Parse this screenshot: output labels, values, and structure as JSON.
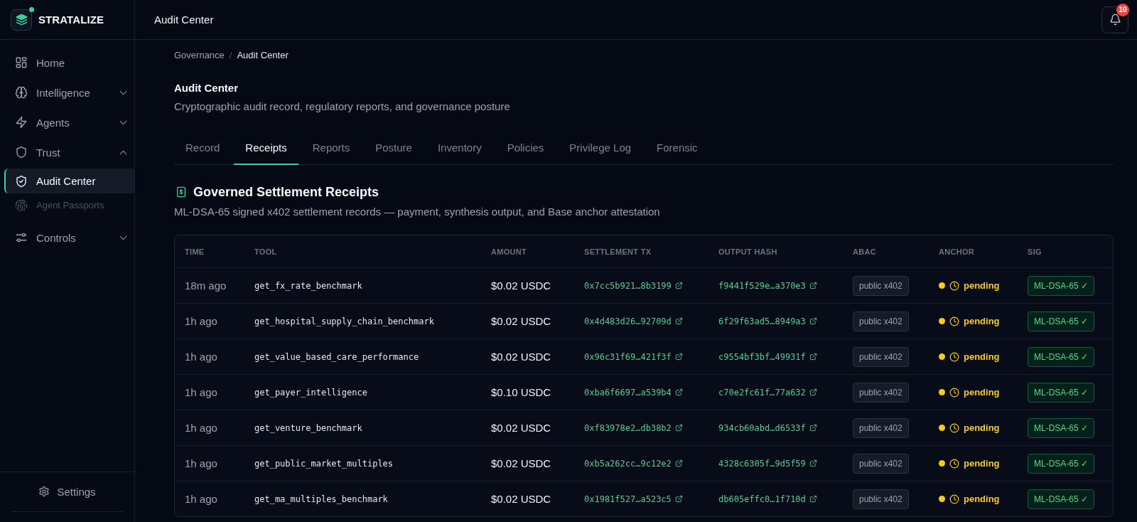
{
  "brand": {
    "name": "STRATALIZE"
  },
  "sidebar": {
    "items": [
      {
        "label": "Home",
        "selected": false
      },
      {
        "label": "Intelligence",
        "selected": false,
        "expanded": false
      },
      {
        "label": "Agents",
        "selected": false,
        "expanded": false
      },
      {
        "label": "Trust",
        "selected": false,
        "expanded": true,
        "children": [
          {
            "label": "Audit Center",
            "selected": true,
            "disabled": false
          },
          {
            "label": "Agent Passports",
            "selected": false,
            "disabled": true
          }
        ]
      },
      {
        "label": "Controls",
        "selected": false,
        "expanded": false
      }
    ],
    "footer": {
      "label": "Settings"
    }
  },
  "header": {
    "title": "Audit Center",
    "notifications": {
      "count": "10"
    }
  },
  "breadcrumb": {
    "items": [
      "Governance",
      "Audit Center"
    ],
    "separator": "/"
  },
  "page": {
    "title": "Audit Center",
    "subtitle": "Cryptographic audit record, regulatory reports, and governance posture"
  },
  "tabs": [
    {
      "label": "Record",
      "selected": false
    },
    {
      "label": "Receipts",
      "selected": true
    },
    {
      "label": "Reports",
      "selected": false
    },
    {
      "label": "Posture",
      "selected": false
    },
    {
      "label": "Inventory",
      "selected": false
    },
    {
      "label": "Policies",
      "selected": false
    },
    {
      "label": "Privilege Log",
      "selected": false
    },
    {
      "label": "Forensic",
      "selected": false
    }
  ],
  "section": {
    "title": "Governed Settlement Receipts",
    "description": "ML-DSA-65 signed x402 settlement records — payment, synthesis output, and Base anchor attestation"
  },
  "table": {
    "columns": [
      "TIME",
      "TOOL",
      "AMOUNT",
      "SETTLEMENT TX",
      "OUTPUT HASH",
      "ABAC",
      "ANCHOR",
      "SIG"
    ],
    "rows": [
      {
        "time": "18m ago",
        "tool": "get_fx_rate_benchmark",
        "amount": "$0.02 USDC",
        "settlement_tx": "0x7cc5b921…8b3199",
        "output_hash": "f9441f529e…a370e3",
        "abac": "public x402",
        "anchor": {
          "kind": "pending",
          "label": "pending"
        },
        "sig": "ML-DSA-65 ✓"
      },
      {
        "time": "1h ago",
        "tool": "get_hospital_supply_chain_benchmark",
        "amount": "$0.02 USDC",
        "settlement_tx": "0x4d483d26…92709d",
        "output_hash": "6f29f63ad5…8949a3",
        "abac": "public x402",
        "anchor": {
          "kind": "pending",
          "label": "pending"
        },
        "sig": "ML-DSA-65 ✓"
      },
      {
        "time": "1h ago",
        "tool": "get_value_based_care_performance",
        "amount": "$0.02 USDC",
        "settlement_tx": "0x96c31f69…421f3f",
        "output_hash": "c9554bf3bf…49931f",
        "abac": "public x402",
        "anchor": {
          "kind": "pending",
          "label": "pending"
        },
        "sig": "ML-DSA-65 ✓"
      },
      {
        "time": "1h ago",
        "tool": "get_payer_intelligence",
        "amount": "$0.10 USDC",
        "settlement_tx": "0xba6f6697…a539b4",
        "output_hash": "c70e2fc61f…77a632",
        "abac": "public x402",
        "anchor": {
          "kind": "pending",
          "label": "pending"
        },
        "sig": "ML-DSA-65 ✓"
      },
      {
        "time": "1h ago",
        "tool": "get_venture_benchmark",
        "amount": "$0.02 USDC",
        "settlement_tx": "0xf83978e2…db38b2",
        "output_hash": "934cb60abd…d6533f",
        "abac": "public x402",
        "anchor": {
          "kind": "pending",
          "label": "pending"
        },
        "sig": "ML-DSA-65 ✓"
      },
      {
        "time": "1h ago",
        "tool": "get_public_market_multiples",
        "amount": "$0.02 USDC",
        "settlement_tx": "0xb5a262cc…9c12e2",
        "output_hash": "4328c6305f…9d5f59",
        "abac": "public x402",
        "anchor": {
          "kind": "pending",
          "label": "pending"
        },
        "sig": "ML-DSA-65 ✓"
      },
      {
        "time": "1h ago",
        "tool": "get_ma_multiples_benchmark",
        "amount": "$0.02 USDC",
        "settlement_tx": "0x1981f527…a523c5",
        "output_hash": "db605effc0…1f710d",
        "abac": "public x402",
        "anchor": {
          "kind": "pending",
          "label": "pending"
        },
        "sig": "ML-DSA-65 ✓"
      }
    ]
  }
}
